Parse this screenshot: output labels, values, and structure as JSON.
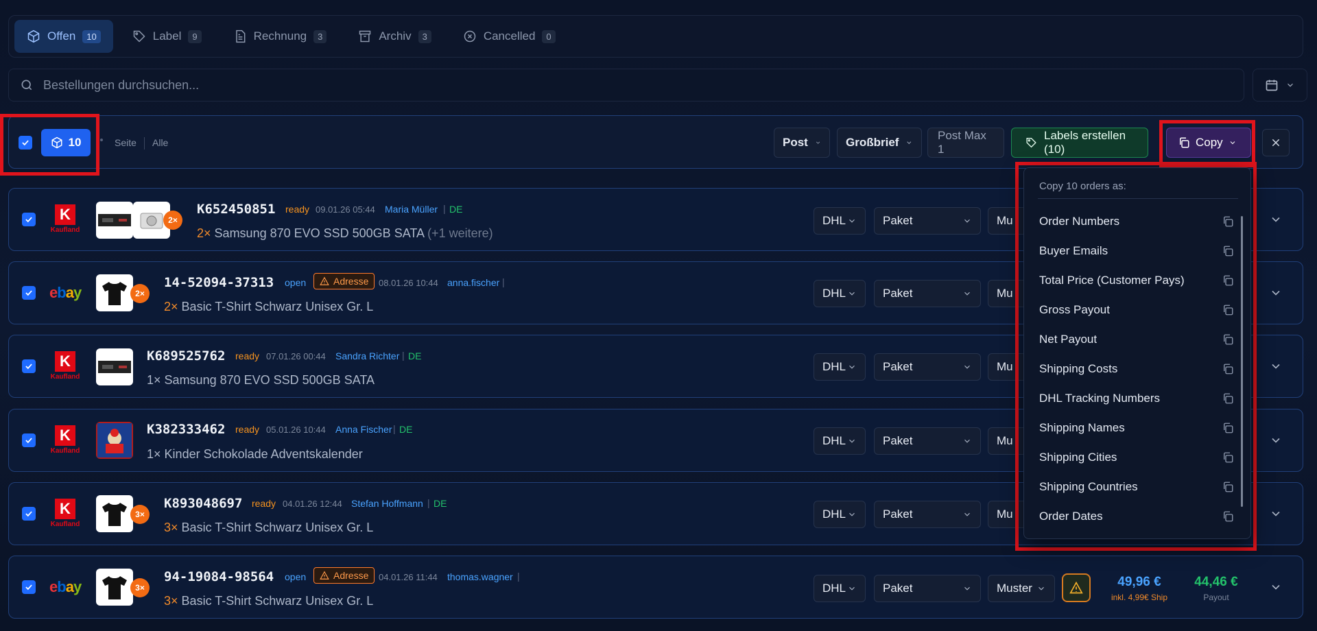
{
  "tabs": [
    {
      "label": "Offen",
      "count": "10",
      "icon": "package-icon"
    },
    {
      "label": "Label",
      "count": "9",
      "icon": "tag-icon"
    },
    {
      "label": "Rechnung",
      "count": "3",
      "icon": "file-icon"
    },
    {
      "label": "Archiv",
      "count": "3",
      "icon": "archive-icon"
    },
    {
      "label": "Cancelled",
      "count": "0",
      "icon": "x-circle-icon"
    }
  ],
  "search": {
    "placeholder": "Bestellungen durchsuchen..."
  },
  "toolbar": {
    "selected_count": "10",
    "page_link": "Seite",
    "all_link": "Alle",
    "carrier": "Post",
    "format": "Großbrief",
    "postmax": "Post Max 1",
    "labels_button": "Labels erstellen (10)",
    "copy_button": "Copy"
  },
  "copy_menu": {
    "heading": "Copy 10 orders as:",
    "items": [
      "Order Numbers",
      "Buyer Emails",
      "Total Price (Customer Pays)",
      "Gross Payout",
      "Net Payout",
      "Shipping Costs",
      "DHL Tracking Numbers",
      "Shipping Names",
      "Shipping Cities",
      "Shipping Countries",
      "Order Dates"
    ]
  },
  "orders": [
    {
      "marketplace": "Kaufland",
      "qty_badge": "2×",
      "order_no": "K652450851",
      "status": "ready",
      "date": "09.01.26 05:44",
      "buyer": "Maria Müller",
      "country": "DE",
      "qty": "2×",
      "product": "Samsung 870 EVO SSD 500GB SATA",
      "more": "(+1 weitere)",
      "carrier": "DHL",
      "type": "Paket",
      "template": "Mu"
    },
    {
      "marketplace": "ebay",
      "qty_badge": "2×",
      "order_no": "14-52094-37313",
      "status": "open",
      "warning": "Adresse",
      "date": "08.01.26 10:44",
      "buyer": "anna.fischer",
      "qty": "2×",
      "product": "Basic T-Shirt Schwarz Unisex Gr. L",
      "carrier": "DHL",
      "type": "Paket",
      "template": "Mu"
    },
    {
      "marketplace": "Kaufland",
      "order_no": "K689525762",
      "status": "ready",
      "date": "07.01.26 00:44",
      "buyer": "Sandra Richter",
      "country": "DE",
      "qty": "1×",
      "product": "Samsung 870 EVO SSD 500GB SATA",
      "carrier": "DHL",
      "type": "Paket",
      "template": "Mu"
    },
    {
      "marketplace": "Kaufland",
      "order_no": "K382333462",
      "status": "ready",
      "date": "05.01.26 10:44",
      "buyer": "Anna Fischer",
      "country": "DE",
      "qty": "1×",
      "product": "Kinder Schokolade Adventskalender",
      "carrier": "DHL",
      "type": "Paket",
      "template": "Mu"
    },
    {
      "marketplace": "Kaufland",
      "qty_badge": "3×",
      "order_no": "K893048697",
      "status": "ready",
      "date": "04.01.26 12:44",
      "buyer": "Stefan Hoffmann",
      "country": "DE",
      "qty": "3×",
      "product": "Basic T-Shirt Schwarz Unisex Gr. L",
      "carrier": "DHL",
      "type": "Paket",
      "template": "Mu"
    },
    {
      "marketplace": "ebay",
      "qty_badge": "3×",
      "order_no": "94-19084-98564",
      "status": "open",
      "warning": "Adresse",
      "date": "04.01.26 11:44",
      "buyer": "thomas.wagner",
      "qty": "3×",
      "product": "Basic T-Shirt Schwarz Unisex Gr. L",
      "carrier": "DHL",
      "type": "Paket",
      "template": "Muster",
      "price": "49,96 €",
      "price_note": "inkl. 4,99€ Ship",
      "payout": "44,46 €",
      "payout_label": "Payout"
    }
  ],
  "logos": {
    "kaufland_text": "Kaufland",
    "kaufland_letter": "K",
    "ebay": [
      "e",
      "b",
      "a",
      "y"
    ]
  },
  "colors": {
    "accent": "#1f62f0",
    "ready": "#f7931e",
    "open": "#4aa3ff",
    "success": "#23c26b",
    "highlight": "#e0141c"
  }
}
